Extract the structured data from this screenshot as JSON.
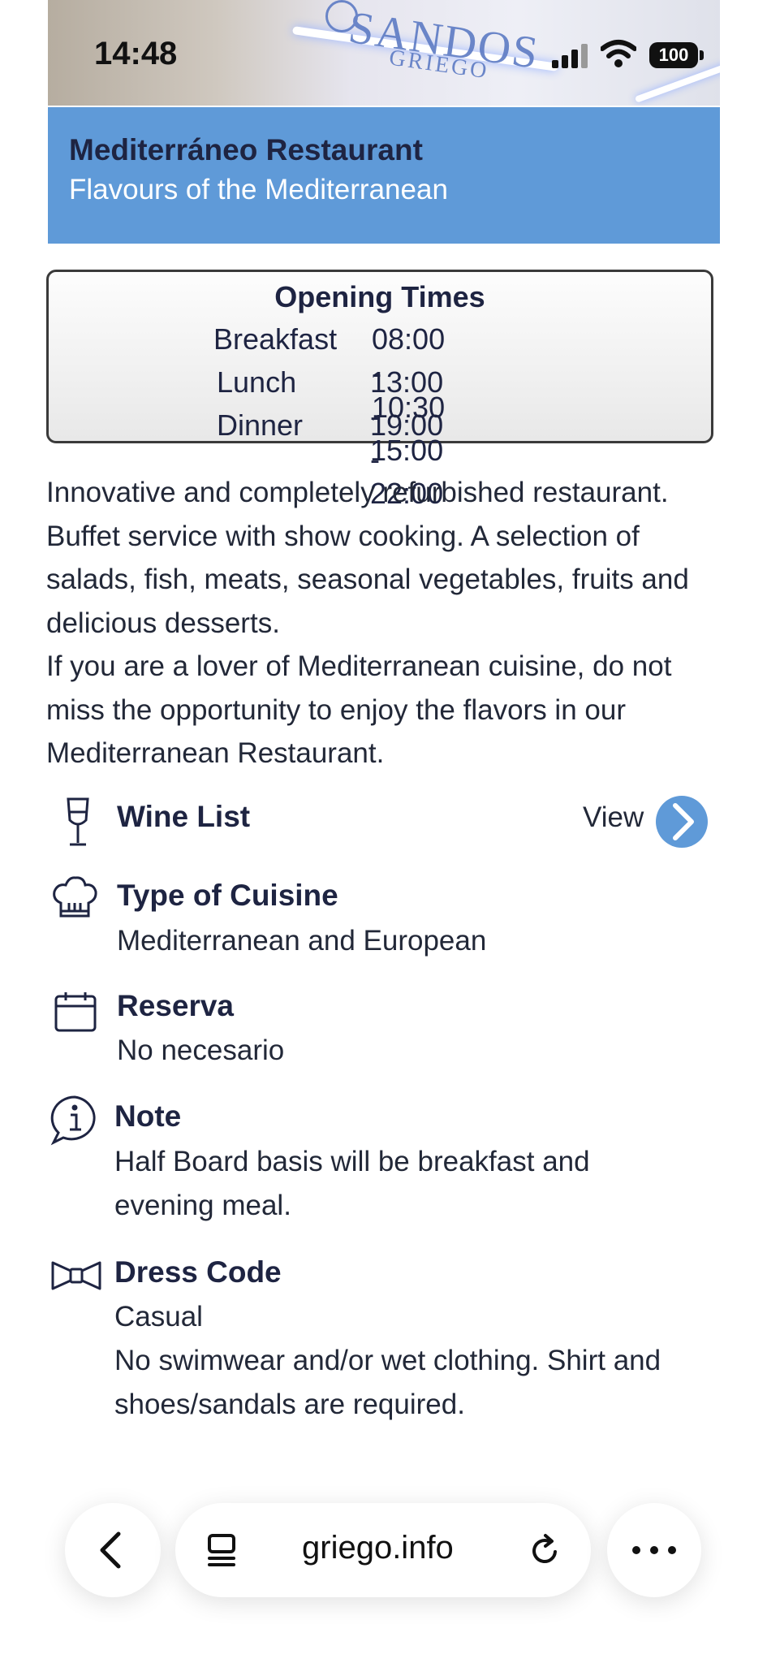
{
  "status_bar": {
    "time": "14:48",
    "battery": "100"
  },
  "hero": {
    "logo_main": "SANDOS",
    "logo_sub": "GRIEGO"
  },
  "header": {
    "title": "Mediterráneo Restaurant",
    "subtitle": "Flavours of the Mediterranean"
  },
  "opening_times": {
    "title": "Opening Times",
    "rows": [
      {
        "meal": "Breakfast",
        "hours": "08:00 - 10:30"
      },
      {
        "meal": "Lunch",
        "hours": "13:00 - 15:00"
      },
      {
        "meal": "Dinner",
        "hours": "19:00 - 22:00"
      }
    ]
  },
  "description": {
    "paragraph1": "Innovative and completely refurbished restaurant. Buffet service with show cooking. A selection of salads, fish, meats, seasonal vegetables, fruits and delicious desserts.",
    "paragraph2": "If you are a lover of Mediterranean cuisine, do not miss the opportunity to enjoy the flavors in our Mediterranean Restaurant."
  },
  "sections": {
    "wine_list": {
      "title": "Wine List",
      "action": "View",
      "icon": "wine-glass-icon"
    },
    "cuisine": {
      "title": "Type of Cuisine",
      "value": "Mediterranean and European",
      "icon": "chef-hat-icon"
    },
    "reservation": {
      "title": "Reserva",
      "value": "No necesario",
      "icon": "calendar-icon"
    },
    "note": {
      "title": "Note",
      "value": "Half Board basis will be breakfast and evening meal.",
      "icon": "info-icon"
    },
    "dress_code": {
      "title": "Dress Code",
      "value": "Casual",
      "detail": "No swimwear and/or wet clothing.  Shirt and shoes/sandals are required.",
      "icon": "bow-tie-icon"
    }
  },
  "browser": {
    "url": "griego.info"
  },
  "colors": {
    "accent_blue": "#5f9ad8",
    "heading_navy": "#1e2442"
  }
}
